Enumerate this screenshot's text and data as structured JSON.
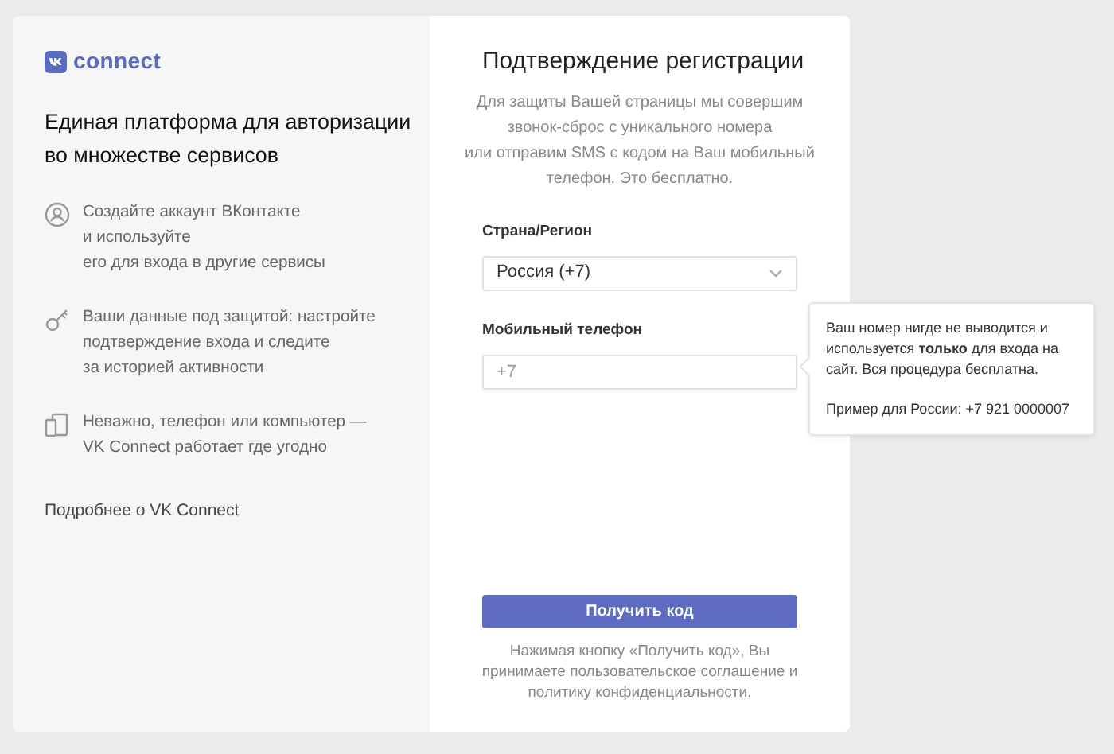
{
  "logo": {
    "text": "connect"
  },
  "heading": "Единая платформа для авторизации\nво множестве сервисов",
  "features": [
    {
      "kind": "person",
      "text": "Создайте аккаунт ВКонтакте\nи используйте\nего для входа в другие сервисы"
    },
    {
      "kind": "key",
      "text": "Ваши данные под защитой: настройте\nподтверждение входа и следите\nза историей активности"
    },
    {
      "kind": "devices",
      "text": "Неважно, телефон или компьютер —\nVK Connect работает где угодно"
    }
  ],
  "more_link": "Подробнее о VK Connect",
  "form": {
    "title": "Подтверждение регистрации",
    "description": "Для защиты Вашей страницы мы совершим\nзвонок-сброс с уникального номера\nили отправим SMS с кодом на Ваш мобильный\nтелефон. Это бесплатно.",
    "country_label": "Страна/Регион",
    "country_value": "Россия (+7)",
    "phone_label": "Мобильный телефон",
    "phone_placeholder": "+7",
    "submit": "Получить код",
    "footnote": "Нажимая кнопку «Получить код», Вы\nпринимаете пользовательское соглашение и\nполитику конфиденциальности."
  },
  "tooltip": {
    "text": "Ваш номер нигде не выводится и\nиспользуется **только** для входа на\nсайт. Вся процедура бесплатна.",
    "example": "Пример для России: +7 921 0000007"
  }
}
